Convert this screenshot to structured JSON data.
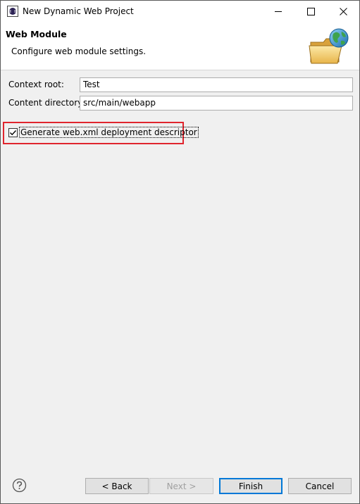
{
  "window": {
    "title": "New Dynamic Web Project",
    "icon": "eclipse-app-icon"
  },
  "banner": {
    "title": "Web Module",
    "description": "Configure web module settings.",
    "icon": "folder-globe-icon"
  },
  "form": {
    "context_root_label": "Context root:",
    "context_root_value": "Test",
    "content_directory_label": "Content directory:",
    "content_directory_value": "src/main/webapp"
  },
  "options": {
    "generate_webxml_label": "Generate web.xml deployment descriptor",
    "generate_webxml_checked": true
  },
  "buttons": {
    "back": "< Back",
    "next": "Next >",
    "finish": "Finish",
    "cancel": "Cancel"
  },
  "colors": {
    "highlight": "#e0252e",
    "default_button_border": "#0078d7"
  }
}
